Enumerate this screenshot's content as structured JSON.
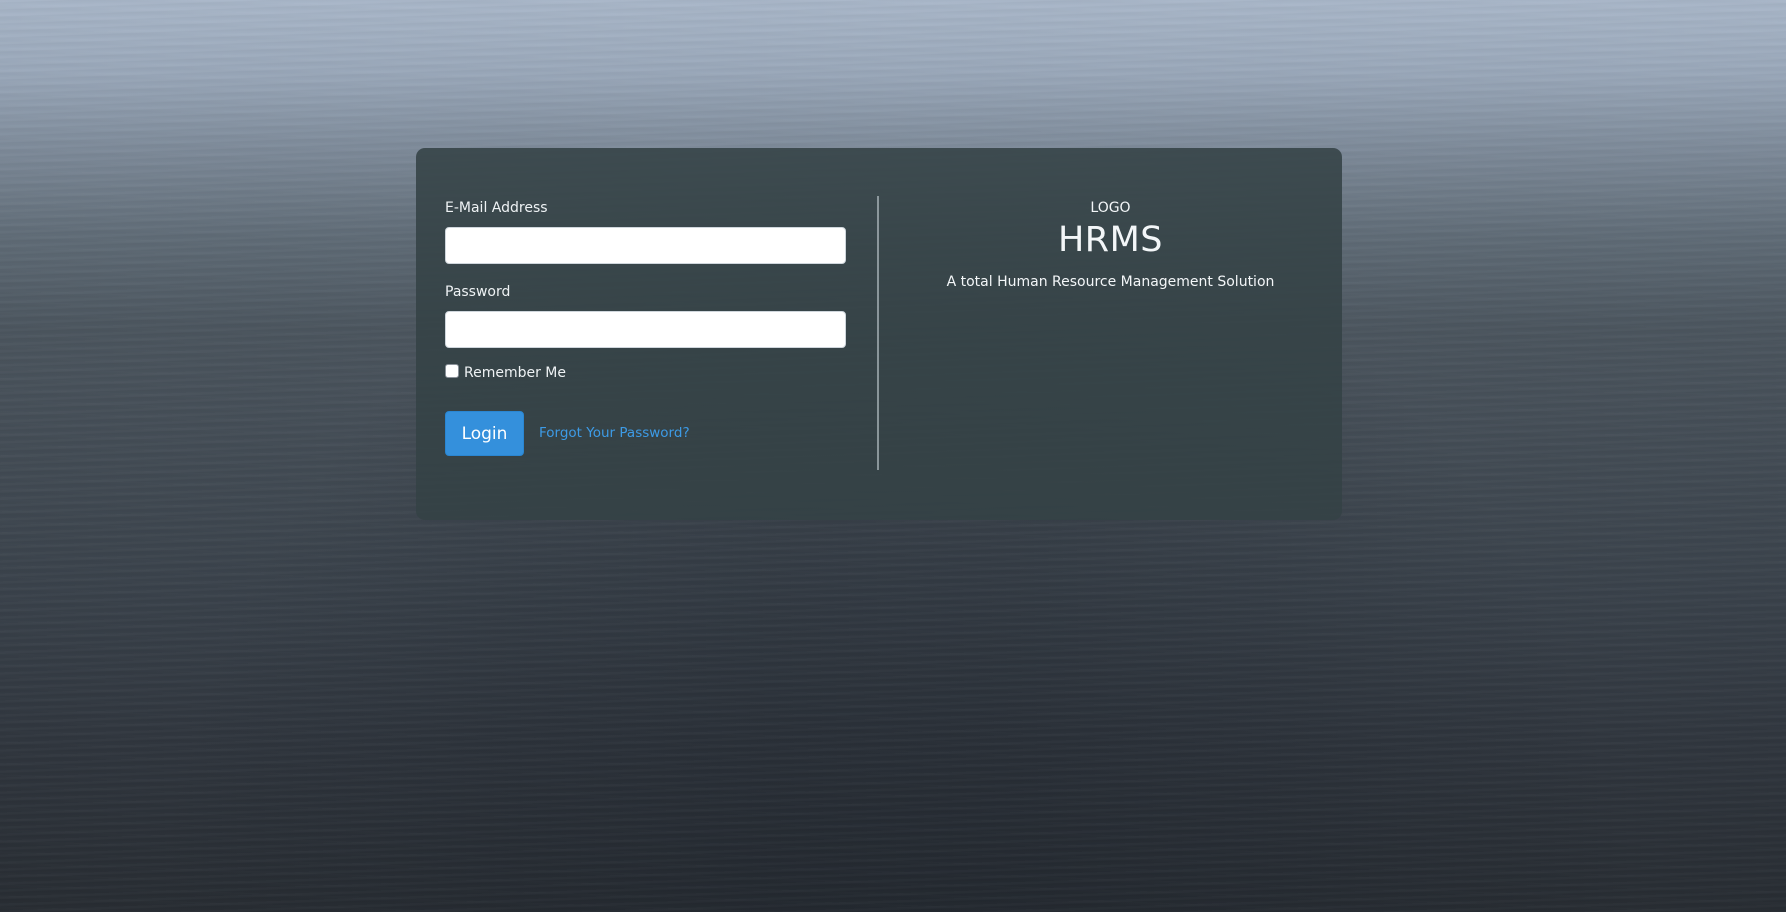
{
  "login_form": {
    "email_label": "E-Mail Address",
    "email_value": "",
    "password_label": "Password",
    "password_value": "",
    "remember_label": "Remember Me",
    "remember_checked": false,
    "login_label": "Login",
    "forgot_label": "Forgot Your Password?"
  },
  "branding": {
    "logo_text": "LOGO",
    "app_name": "HRMS",
    "tagline": "A total Human Resource Management Solution"
  },
  "colors": {
    "primary_button": "#3490dc",
    "link": "#3d9be6",
    "card_background": "#344246"
  }
}
